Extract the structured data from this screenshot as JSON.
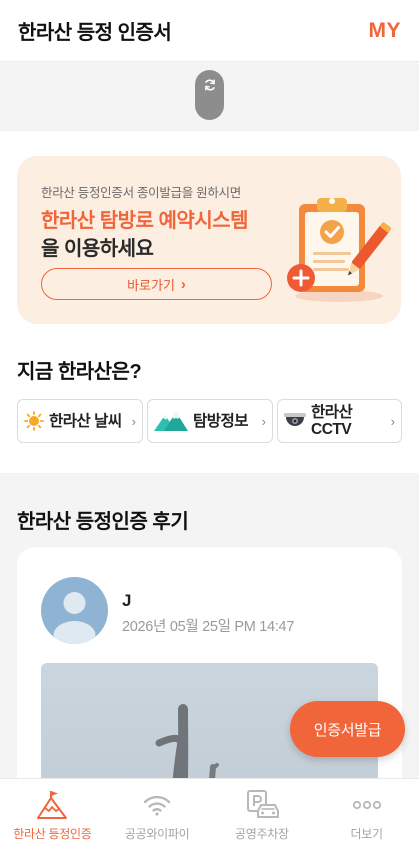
{
  "header": {
    "title": "한라산 등정 인증서",
    "my_label": "MY"
  },
  "banner": {
    "subtitle": "한라산 등정인증서 종이발급을 원하시면",
    "highlight": "한라산 탐방로 예약시스템",
    "line2": "을 이용하세요",
    "button_label": "바로가기"
  },
  "now": {
    "title": "지금 한라산은?",
    "buttons": [
      {
        "label": "한라산 날씨",
        "icon": "sun-icon"
      },
      {
        "label": "탐방정보",
        "icon": "mountain-icon"
      },
      {
        "label_line1": "한라산",
        "label_line2": "CCTV",
        "icon": "cctv-icon"
      }
    ]
  },
  "reviews": {
    "title": "한라산 등정인증 후기",
    "items": [
      {
        "name": "J",
        "date": "2026년 05월 25일 PM 14:47"
      }
    ]
  },
  "fab_label": "인증서발급",
  "tabs": [
    {
      "label": "한라산 등정인증",
      "icon": "mountain-flag-icon",
      "active": true
    },
    {
      "label": "공공와이파이",
      "icon": "wifi-icon",
      "active": false
    },
    {
      "label": "공영주차장",
      "icon": "parking-icon",
      "active": false
    },
    {
      "label": "더보기",
      "icon": "more-icon",
      "active": false
    }
  ],
  "colors": {
    "accent": "#f0653a",
    "banner_bg": "#fdeee2",
    "page_bg": "#f4f4f5"
  }
}
